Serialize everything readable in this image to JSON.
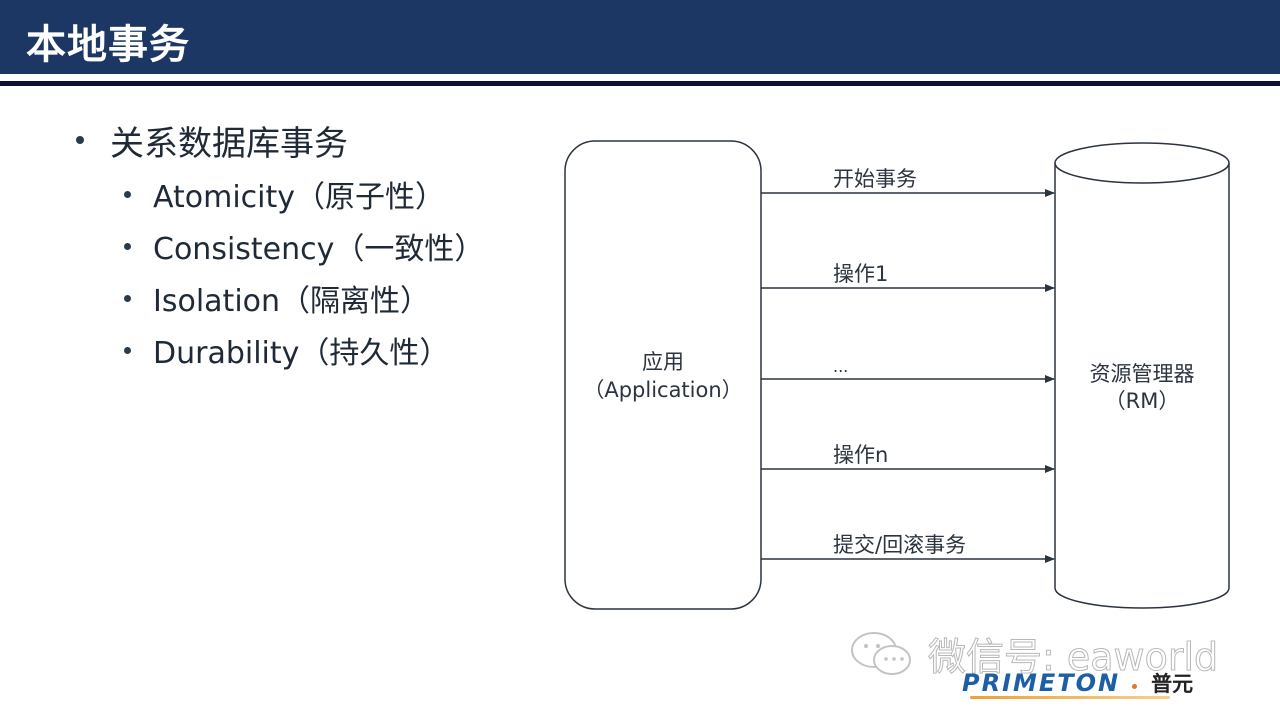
{
  "slide": {
    "title": "本地事务",
    "bullets": {
      "main": "关系数据库事务",
      "sub": [
        "Atomicity（原子性）",
        "Consistency（一致性）",
        "Isolation（隔离性）",
        "Durability（持久性）"
      ]
    }
  },
  "diagram": {
    "app_box": {
      "line1": "应用",
      "line2": "（Application）"
    },
    "rm_cylinder": {
      "line1": "资源管理器",
      "line2": "（RM）"
    },
    "arrows": [
      {
        "label": "开始事务"
      },
      {
        "label": "操作1"
      },
      {
        "label": "..."
      },
      {
        "label": "操作n"
      },
      {
        "label": "提交/回滚事务"
      }
    ]
  },
  "watermark": {
    "icon": "wechat-icon",
    "text": "微信号: eaworld"
  },
  "logo": {
    "brand": "PRIMETON",
    "chinese": "普元"
  },
  "colors": {
    "header_bg": "#1c3763",
    "rule": "#0b1136",
    "text": "#1f2a36"
  }
}
